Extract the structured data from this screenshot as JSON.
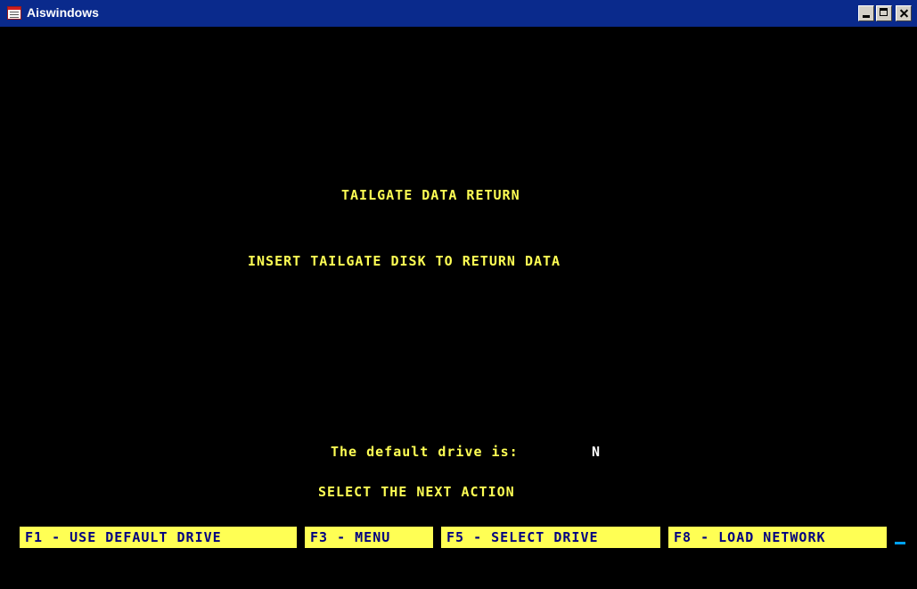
{
  "window": {
    "title": "Aiswindows",
    "icon": "app-window-icon",
    "controls": [
      "minimize-icon",
      "maximize-icon",
      "close-icon"
    ]
  },
  "screen": {
    "heading": "TAILGATE DATA RETURN",
    "instruction": "INSERT TAILGATE DISK TO RETURN DATA",
    "default_drive_label": "The default drive is:",
    "default_drive_value": "N",
    "prompt": "SELECT THE NEXT ACTION"
  },
  "function_keys": [
    {
      "label": "F1 - USE DEFAULT DRIVE"
    },
    {
      "label": "F3 - MENU"
    },
    {
      "label": "F5 - SELECT DRIVE"
    },
    {
      "label": "F8 - LOAD NETWORK"
    }
  ],
  "colors": {
    "background": "#000000",
    "text": "#ffff54",
    "highlight_value": "#ffffff",
    "key_background": "#ffff54",
    "key_text": "#000080",
    "titlebar": "#0a2a8c"
  }
}
